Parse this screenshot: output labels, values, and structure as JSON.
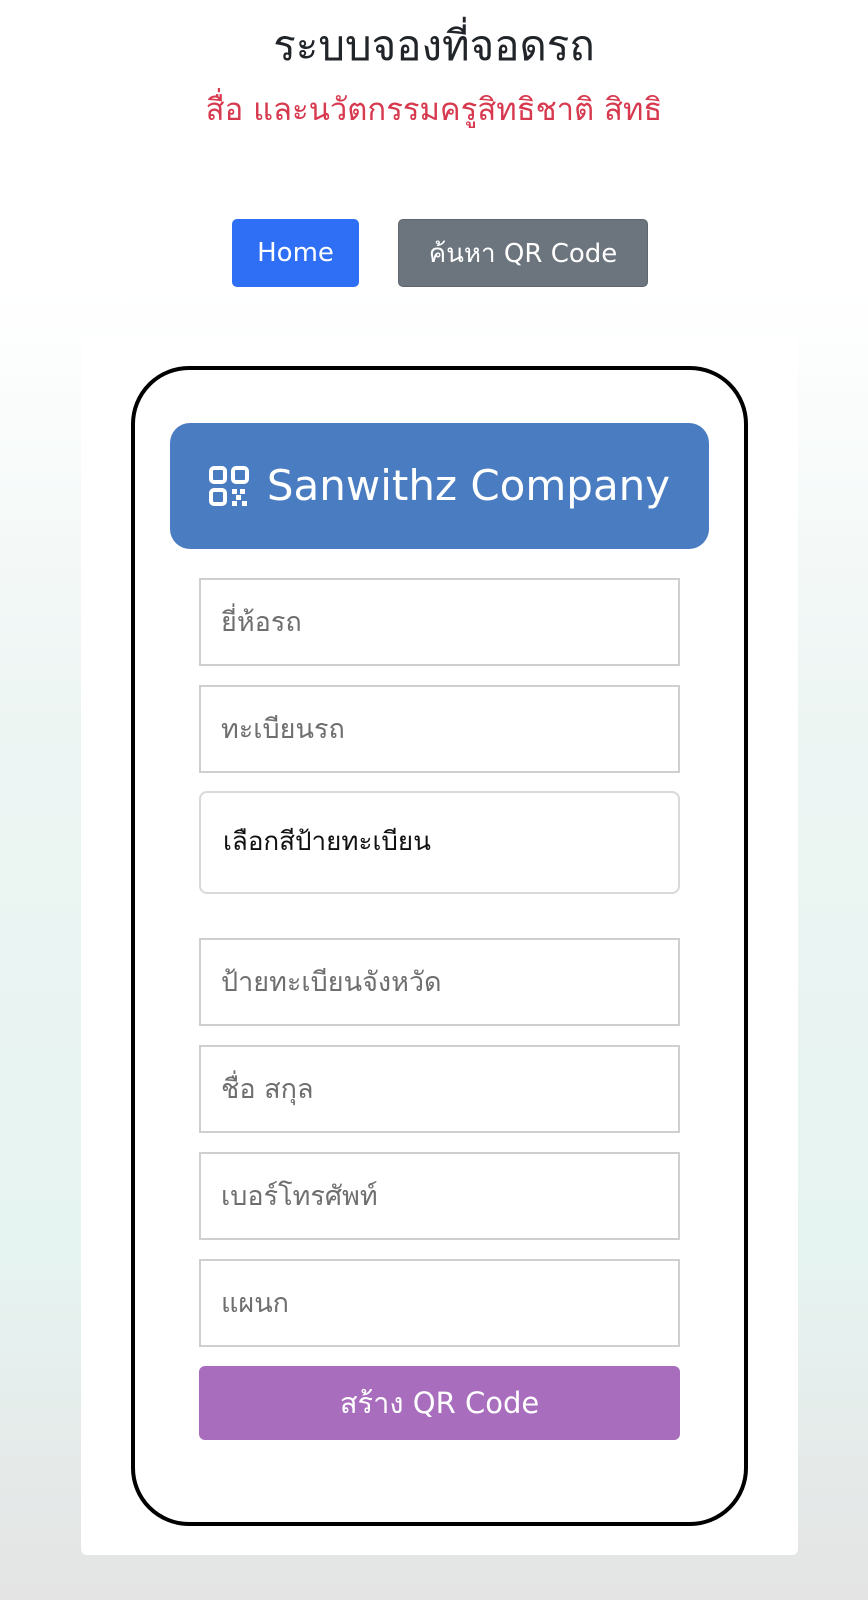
{
  "page": {
    "title": "ระบบจองที่จอดรถ",
    "subtitle": "สื่อ และนวัตกรรมครูสิทธิชาติ สิทธิ"
  },
  "nav": {
    "home_label": "Home",
    "search_label": "ค้นหา QR Code"
  },
  "card": {
    "icon": "qr-code-icon",
    "brand": "Sanwithz Company"
  },
  "form": {
    "brand_placeholder": "ยี่ห้อรถ",
    "plate_placeholder": "ทะเบียนรถ",
    "plate_color_selected": "เลือกสีป้ายทะเบียน",
    "province_placeholder": "ป้ายทะเบียนจังหวัด",
    "name_placeholder": "ชื่อ สกุล",
    "phone_placeholder": "เบอร์โทรศัพท์",
    "department_placeholder": "แผนก",
    "submit_label": "สร้าง QR Code"
  },
  "colors": {
    "title": "#212529",
    "subtitle": "#d7394f",
    "home_button": "#2f6ff5",
    "search_button": "#6c757d",
    "card_header": "#4a7cc2",
    "submit_button": "#a86dbd"
  }
}
